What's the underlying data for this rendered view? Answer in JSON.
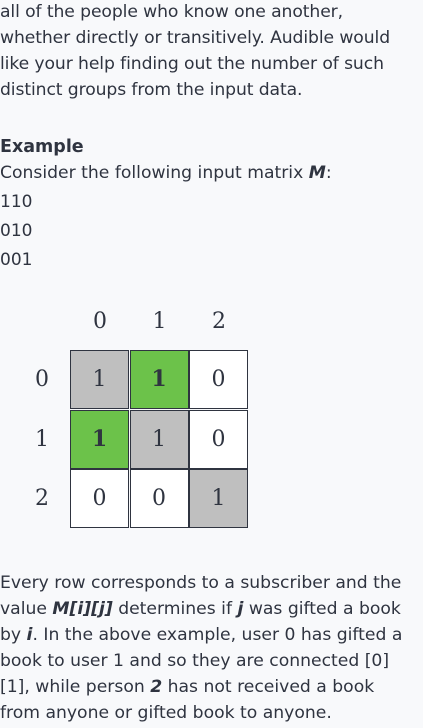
{
  "intro": {
    "lines": [
      "all of the people who know one another,",
      "whether directly or transitively. Audible would",
      "like your help finding out the number of such",
      "distinct groups from the input data."
    ]
  },
  "example": {
    "heading": "Example",
    "desc_before": "Consider the following input matrix ",
    "desc_var": "M",
    "desc_after": ":",
    "rows": [
      "110",
      "010",
      "001"
    ]
  },
  "grid": {
    "col_labels": [
      "0",
      "1",
      "2"
    ],
    "row_labels": [
      "0",
      "1",
      "2"
    ],
    "cells": [
      [
        {
          "v": "1",
          "fill": "gray"
        },
        {
          "v": "1",
          "fill": "green",
          "bold": true
        },
        {
          "v": "0",
          "fill": "white"
        }
      ],
      [
        {
          "v": "1",
          "fill": "green",
          "bold": true
        },
        {
          "v": "1",
          "fill": "gray"
        },
        {
          "v": "0",
          "fill": "white"
        }
      ],
      [
        {
          "v": "0",
          "fill": "white"
        },
        {
          "v": "0",
          "fill": "white"
        },
        {
          "v": "1",
          "fill": "gray"
        }
      ]
    ],
    "colors": {
      "gray": "#bfbfbf",
      "green": "#6cc24a",
      "white": "#ffffff"
    }
  },
  "outro": {
    "l1": "Every row corresponds to a subscriber and the",
    "l2_a": "value ",
    "l2_var": "M[i][j]",
    "l2_b": " determines if ",
    "l2_var2": "j",
    "l2_c": " was gifted a book",
    "l3_a": "by ",
    "l3_var": "i",
    "l3_b": ". In the above example, user 0 has gifted a",
    "l4": "book to user 1 and so they are connected [0]",
    "l5_a": "[1], while person ",
    "l5_var": "2",
    "l5_b": " has not received a book",
    "l6": "from anyone or gifted book to anyone."
  }
}
